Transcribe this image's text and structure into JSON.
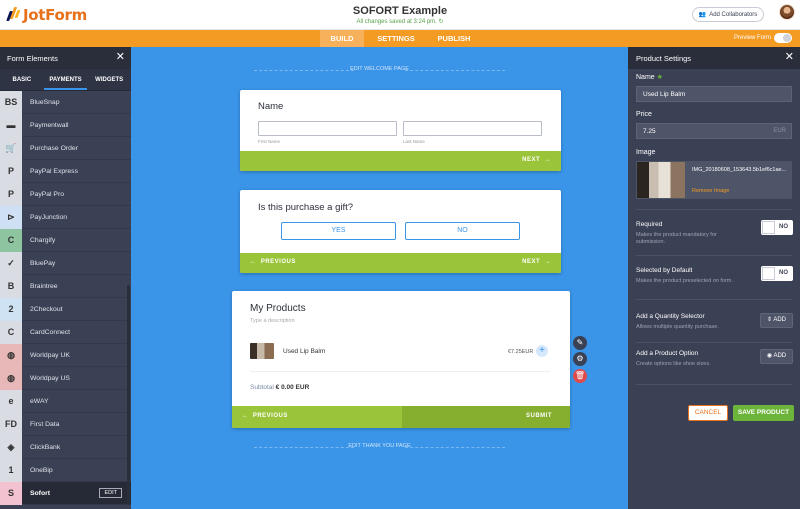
{
  "header": {
    "logo": "JotForm",
    "title": "SOFORT Example",
    "status": "All changes saved at 3:24 pm.",
    "collab_label": "Add Collaborators"
  },
  "nav": {
    "tabs": [
      "BUILD",
      "SETTINGS",
      "PUBLISH"
    ],
    "active": "BUILD",
    "preview_label": "Preview Form"
  },
  "left_panel": {
    "title": "Form Elements",
    "tabs": [
      "BASIC",
      "PAYMENTS",
      "WIDGETS"
    ],
    "active_tab": "PAYMENTS",
    "items": [
      {
        "label": "BlueSnap",
        "icon": "BS"
      },
      {
        "label": "Paymentwall",
        "icon": "▬"
      },
      {
        "label": "Purchase Order",
        "icon": "🛒"
      },
      {
        "label": "PayPal Express",
        "icon": "P"
      },
      {
        "label": "PayPal Pro",
        "icon": "P"
      },
      {
        "label": "PayJunction",
        "icon": "⊳"
      },
      {
        "label": "Chargify",
        "icon": "C"
      },
      {
        "label": "BluePay",
        "icon": "✓"
      },
      {
        "label": "Braintree",
        "icon": "B"
      },
      {
        "label": "2Checkout",
        "icon": "2"
      },
      {
        "label": "CardConnect",
        "icon": "C"
      },
      {
        "label": "Worldpay UK",
        "icon": "◍"
      },
      {
        "label": "Worldpay US",
        "icon": "◍"
      },
      {
        "label": "eWAY",
        "icon": "e"
      },
      {
        "label": "First Data",
        "icon": "FD"
      },
      {
        "label": "ClickBank",
        "icon": "◈"
      },
      {
        "label": "OneBip",
        "icon": "1"
      },
      {
        "label": "Sofort",
        "icon": "S"
      }
    ],
    "edit_label": "EDIT"
  },
  "canvas": {
    "welcome_label": "EDIT WELCOME PAGE",
    "thankyou_label": "EDIT THANK YOU PAGE",
    "card1": {
      "title": "Name",
      "first_label": "First Name",
      "last_label": "Last Name",
      "next": "NEXT"
    },
    "card2": {
      "title": "Is this purchase a gift?",
      "yes": "YES",
      "no": "NO",
      "previous": "PREVIOUS",
      "next": "NEXT"
    },
    "card3": {
      "title": "My Products",
      "description": "Type a description",
      "product_name": "Used Lip Balm",
      "product_price": "€7.25EUR",
      "subtotal_label": "Subtotal",
      "subtotal_value": "€ 0.00 EUR",
      "previous": "PREVIOUS",
      "submit": "SUBMIT"
    }
  },
  "right_panel": {
    "title": "Product Settings",
    "name_label": "Name",
    "name_value": "Used Lip Balm",
    "price_label": "Price",
    "price_value": "7.25",
    "price_unit": "EUR",
    "image_label": "Image",
    "image_filename": "IMG_20180608_153643.5b1ef6c1ae...",
    "remove_image": "Remove Image",
    "required_label": "Required",
    "required_desc": "Makes the product mandatory for submission.",
    "required_value": "NO",
    "selected_label": "Selected by Default",
    "selected_desc": "Makes the product preselected on form.",
    "selected_value": "NO",
    "qty_label": "Add a Quantity Selector",
    "qty_desc": "Allows multiple quantity purchase.",
    "qty_button": "ADD",
    "option_label": "Add a Product Option",
    "option_desc": "Create options like shoe sizes.",
    "option_button": "ADD",
    "cancel": "CANCEL",
    "save": "SAVE PRODUCT"
  },
  "colors": {
    "brand_orange": "#f49b24",
    "canvas_blue": "#3a94e8",
    "panel_dark": "#3b4154",
    "green": "#9ac43a",
    "save_green": "#6db43b"
  }
}
